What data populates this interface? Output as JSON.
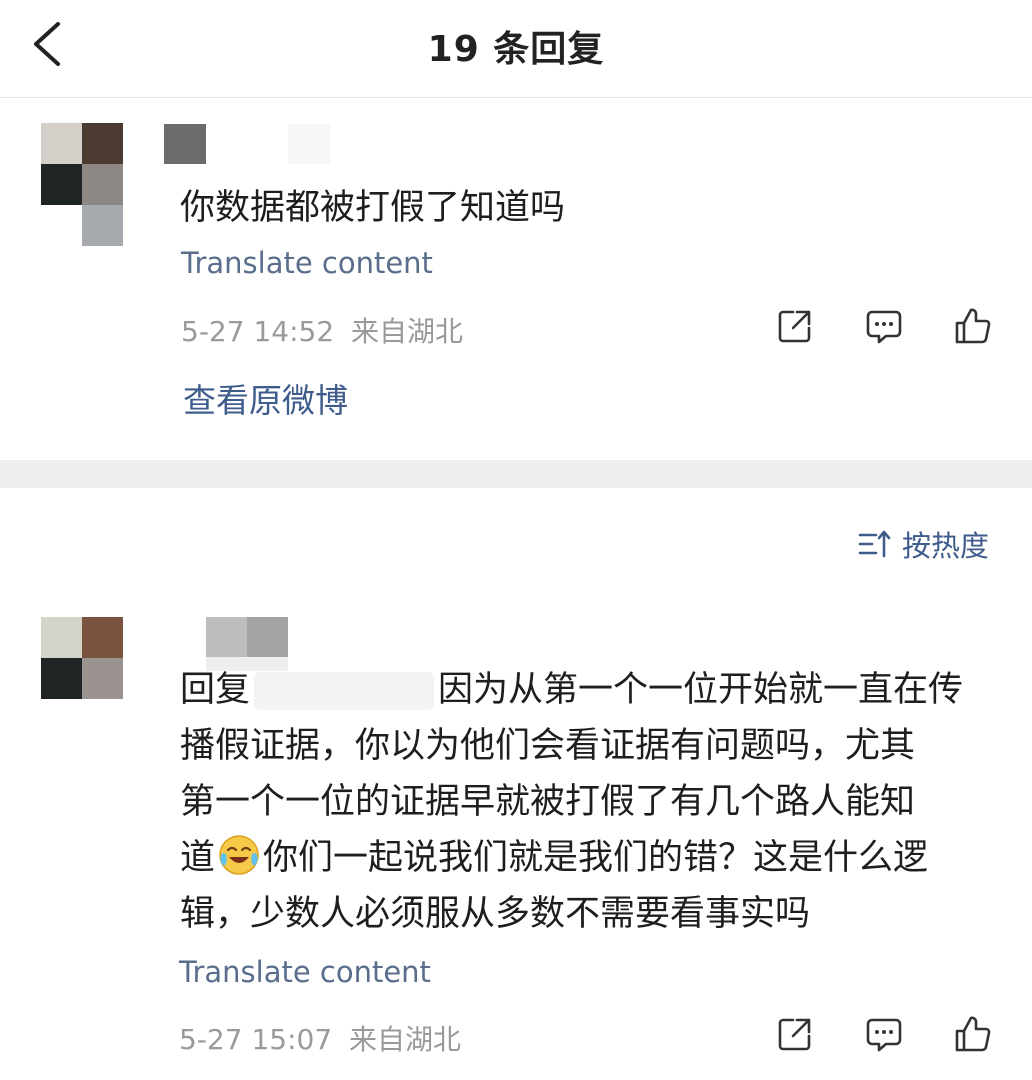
{
  "header": {
    "title": "19 条回复"
  },
  "original_comment": {
    "text": "你数据都被打假了知道吗",
    "translate_label": "Translate content",
    "date": "5-27 14:52",
    "location": "来自湖北",
    "view_original_label": "查看原微博"
  },
  "sort": {
    "label": "按热度"
  },
  "reply": {
    "prefix": "回复",
    "line1": "因为从第一个一位开始就一直在传",
    "line2": "播假证据，你以为他们会看证据有问题吗，尤其",
    "line3": "第一个一位的证据早就被打假了有几个路人能知",
    "line4a": "道",
    "line4b": "你们一起说我们就是我们的错？这是什么逻",
    "line5": "辑，少数人必须服从多数不需要看事实吗",
    "translate_label": "Translate content",
    "date": "5-27 15:07",
    "location": "来自湖北"
  },
  "icons": {
    "back": "chevron-left-icon",
    "share": "share-icon",
    "comment": "comment-icon",
    "like": "thumbs-up-icon",
    "sort": "sort-icon",
    "emoji": "laughing-crying-emoji"
  }
}
